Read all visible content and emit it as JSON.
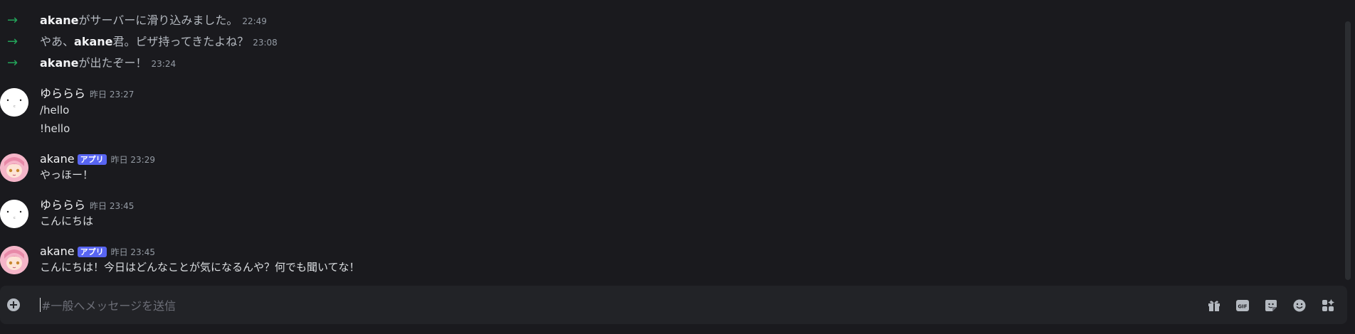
{
  "system_messages": [
    {
      "username": "akane",
      "prefix": "",
      "suffix": "がサーバーに滑り込みました。",
      "time": "22:49"
    },
    {
      "username": "akane",
      "prefix": "やあ、",
      "suffix": "君。ピザ持ってきたよね？",
      "time": "23:08"
    },
    {
      "username": "akane",
      "prefix": "",
      "suffix": "が出たぞー！",
      "time": "23:24"
    }
  ],
  "messages": [
    {
      "username": "ゆららら",
      "badge": "",
      "time": "昨日 23:27",
      "lines": [
        "/hello",
        "!hello"
      ]
    },
    {
      "username": "akane",
      "badge": "アプリ",
      "time": "昨日 23:29",
      "lines": [
        "やっほー！"
      ]
    },
    {
      "username": "ゆららら",
      "badge": "",
      "time": "昨日 23:45",
      "lines": [
        "こんにちは"
      ]
    },
    {
      "username": "akane",
      "badge": "アプリ",
      "time": "昨日 23:45",
      "lines": [
        "こんにちは！今日はどんなことが気になるんや？何でも聞いてな！"
      ]
    }
  ],
  "composer": {
    "placeholder": "#一般へメッセージを送信",
    "icons": [
      "plus-circle-icon",
      "gift-icon",
      "gif-icon",
      "sticker-icon",
      "emoji-icon",
      "apps-icon"
    ],
    "gif_label": "GIF"
  },
  "colors": {
    "background": "#1a1a1e",
    "join_arrow": "#23a55a",
    "badge": "#5865f2"
  }
}
